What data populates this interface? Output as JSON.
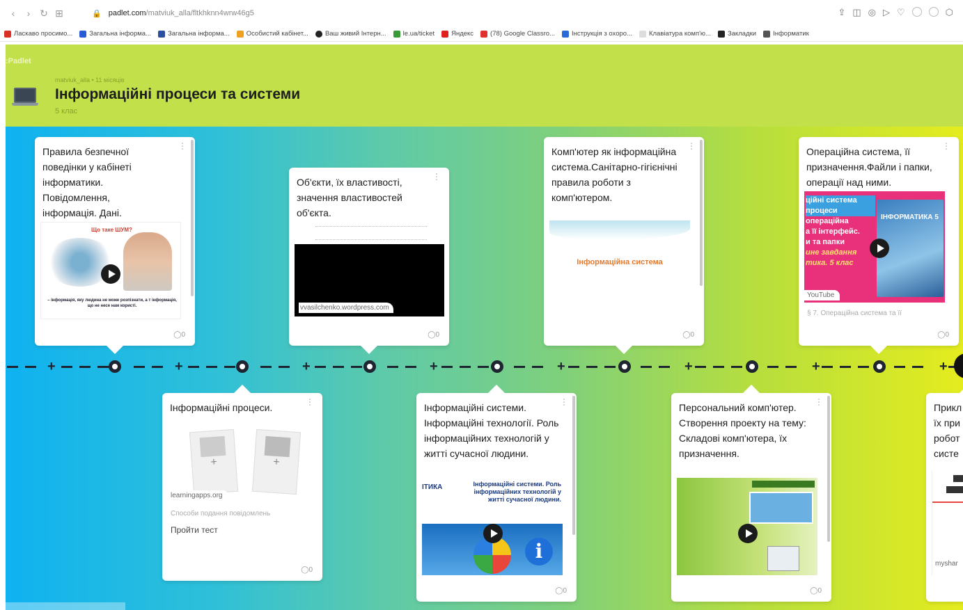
{
  "browser": {
    "url_host": "padlet.com",
    "url_path": "/matviuk_alla/fltkhknn4wrw46g5",
    "bookmarks": [
      "Ласкаво просимо...",
      "Загальна інформа...",
      "Загальна інформа...",
      "Особистий кабінет...",
      "Ваш живий Інтерн...",
      "le.ua/ticket",
      "Яндекс",
      "(78) Google Classro...",
      "Інструкція з охоро...",
      "Клавіатура комп'ю...",
      "Закладки",
      "Інформатик"
    ]
  },
  "header": {
    "logo": ":Padlet",
    "author_line": "matviuk_alla • 11 місяців",
    "title": "Інформаційні процеси та системи",
    "subtitle": "5 клас"
  },
  "cards": [
    {
      "text": "Правила безпечної поведінки у кабінеті інформатики. Повідомлення, інформація. Дані.",
      "thumb_title": "Що таке ШУМ?",
      "thumb_caption": "– інформація, яку людина не може розпізнати, а т інформація, що не несе нам користі.",
      "comments": "0"
    },
    {
      "text": "Об'єкти, їх властивості, значення властивостей об'єкта.",
      "source": "vvasilchenko.wordpress.com",
      "comments": "0"
    },
    {
      "text": "Комп'ютер як інформаційна система.Санітарно-гігієнічні правила роботи з комп'ютером.",
      "thumb_title": "Інформаційна система",
      "comments": "0"
    },
    {
      "text": "Операційна система, її призначення.Файли і папки, операції над ними.",
      "thumb_lines": [
        "ційні система",
        "процеси",
        "операційна",
        "а її інтерфейс.",
        "и та папки",
        "ине завдання",
        "тика. 5 клас"
      ],
      "book_label": "ІНФОРМАТИКА 5",
      "source": "YouTube",
      "mini_title": "§ 7. Операційна система та її",
      "comments": "0"
    },
    {
      "text": "Інформаційні процеси.",
      "source": "learningapps.org",
      "mini_title": "Способи подання повідомлень",
      "link": "Пройти тест",
      "comments": "0"
    },
    {
      "text": "Інформаційні системи. Інформаційні технології. Роль інформаційних технологій у житті сучасної людини.",
      "thumb_title": "Інформаційні системи. Роль інформаційних технологій у житті сучасної людини.",
      "thumb_side": "ІТИКА",
      "comments": "0"
    },
    {
      "text": "Персональний комп'ютер. Створення проекту на тему: Складові комп'ютера, їх призначення.",
      "comments": "0"
    },
    {
      "text": "Прикл їх при робот систе",
      "source": "myshar"
    }
  ]
}
